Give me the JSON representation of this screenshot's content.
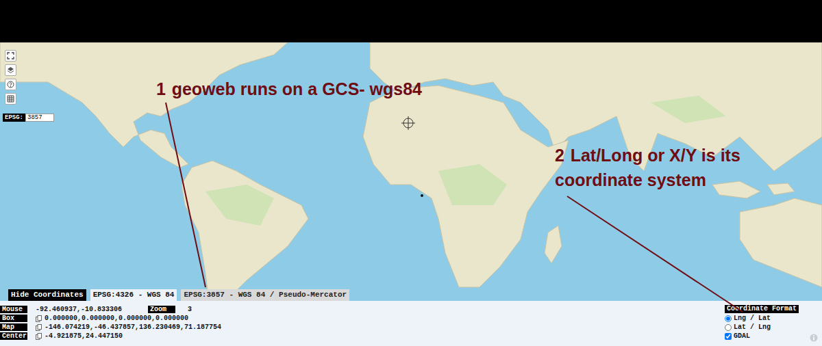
{
  "epsg_field": {
    "label": "EPSG:",
    "value": "3857"
  },
  "annotations": [
    {
      "number": "1",
      "text": "geoweb runs on a GCS- wgs84"
    },
    {
      "number": "2",
      "text": "Lat/Long or X/Y is its coordinate system"
    }
  ],
  "hide_button": "Hide Coordinates",
  "tabs": [
    {
      "label": "EPSG:4326 - WGS 84",
      "selected": true
    },
    {
      "label": "EPSG:3857 - WGS 84 / Pseudo-Mercator",
      "selected": false
    }
  ],
  "readouts": [
    {
      "kind": "plain",
      "label": "Mouse",
      "value": "-92.460937,-10.833306",
      "extra": {
        "label": "Zoom",
        "value": "3"
      }
    },
    {
      "kind": "copyable",
      "label": "Box",
      "value": "0.000000,0.000000,0.000000,0.000000"
    },
    {
      "kind": "copyable",
      "label": "Map",
      "value": "-146.074219,-46.437857,136.230469,71.187754"
    },
    {
      "kind": "copyable",
      "label": "Center",
      "value": "-4.921875,24.447150"
    }
  ],
  "coordinate_format": {
    "title": "Coordinate Format",
    "options": [
      {
        "label": "Lng / Lat",
        "selected": true
      },
      {
        "label": "Lat / Lng",
        "selected": false
      }
    ],
    "gdal": {
      "label": "GDAL",
      "checked": true
    }
  }
}
